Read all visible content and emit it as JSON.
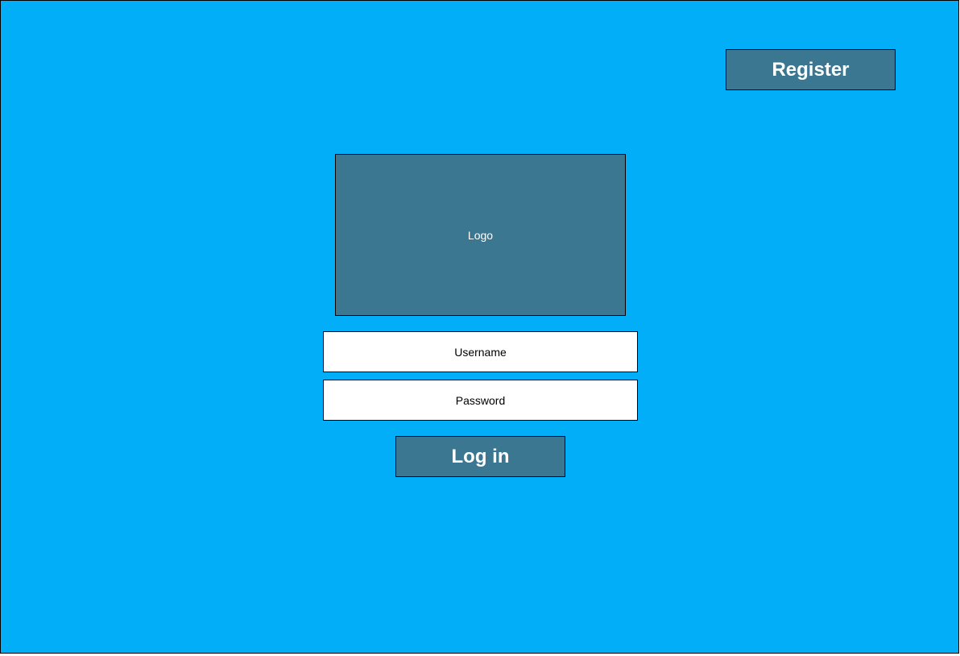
{
  "header": {
    "register_label": "Register"
  },
  "logo": {
    "label": "Logo"
  },
  "form": {
    "username": {
      "value": "",
      "placeholder": "Username"
    },
    "password": {
      "value": "",
      "placeholder": "Password"
    },
    "login_label": "Log in"
  },
  "colors": {
    "background": "#03aef9",
    "accent": "#3b7790",
    "field_background": "#ffffff",
    "text_on_accent": "#ffffff"
  }
}
